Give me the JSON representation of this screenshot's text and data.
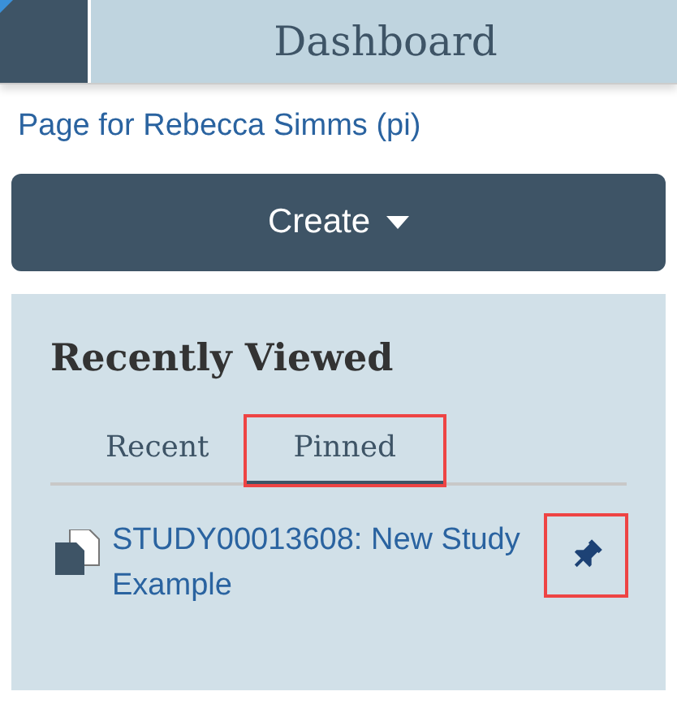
{
  "header": {
    "title": "Dashboard"
  },
  "page_link": "Page for Rebecca Simms (pi)",
  "create_button": {
    "label": "Create"
  },
  "recently_viewed": {
    "title": "Recently Viewed",
    "tabs": [
      {
        "label": "Recent",
        "selected": false,
        "highlighted": false
      },
      {
        "label": "Pinned",
        "selected": true,
        "highlighted": true
      }
    ],
    "items": [
      {
        "title": "STUDY00013608: New Study Example",
        "pinned": true,
        "highlighted": true
      }
    ]
  }
}
